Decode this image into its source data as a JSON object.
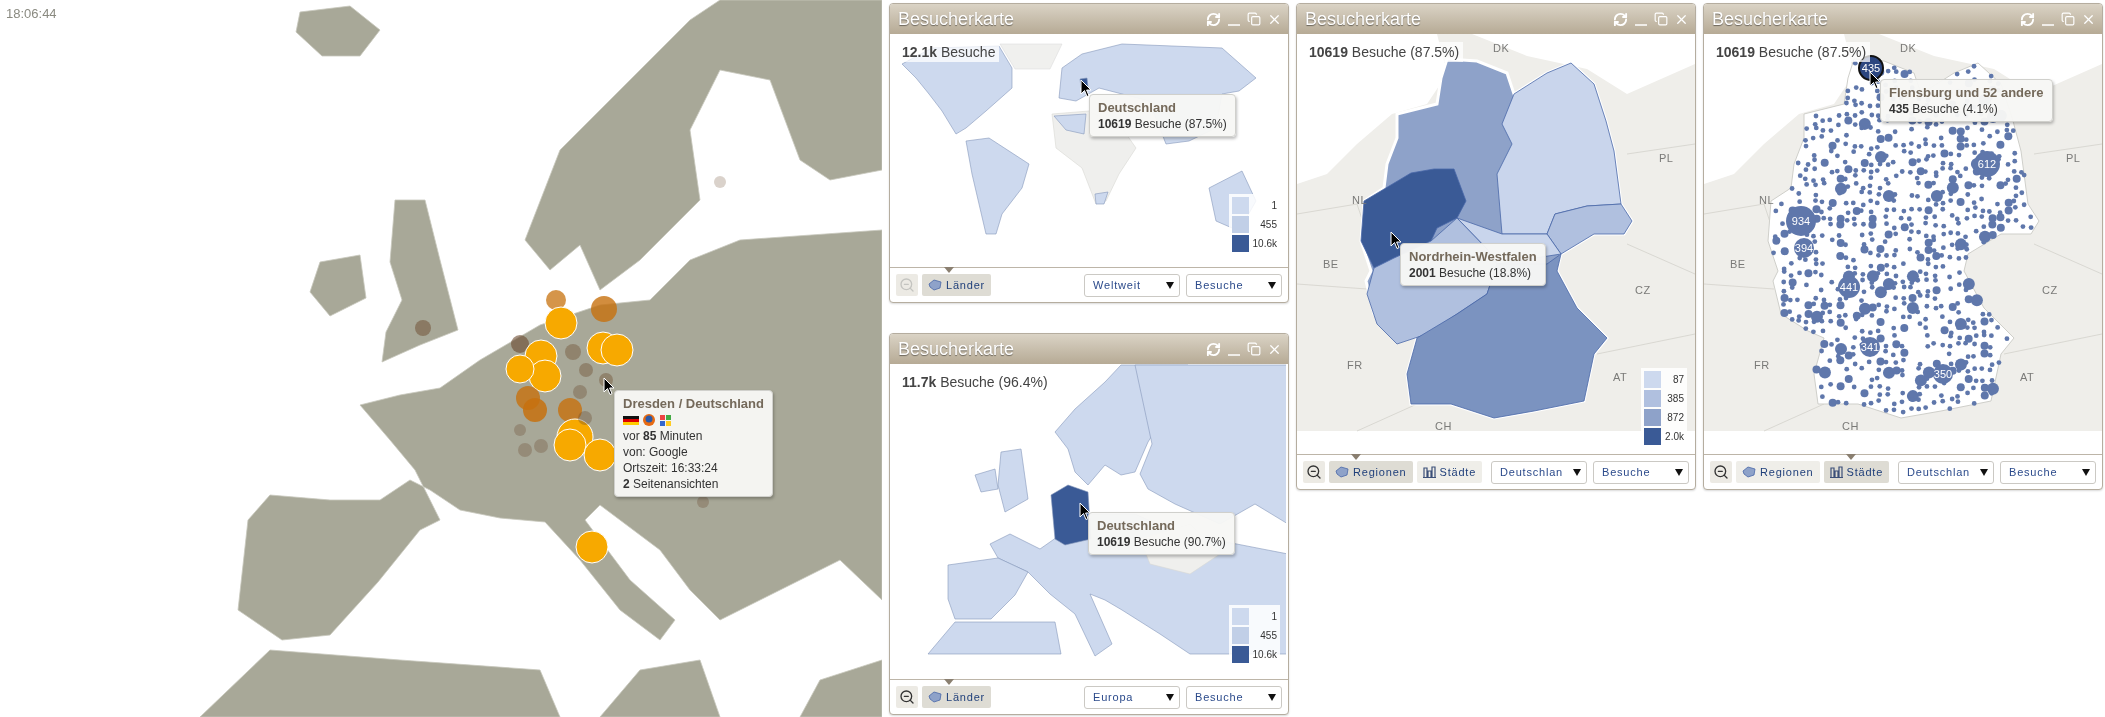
{
  "clock": "18:06:44",
  "live_map": {
    "tooltip": {
      "title": "Dresden / Deutschland",
      "lines": [
        "vor **85** Minuten",
        "von: Google",
        "Ortszeit: 16:33:24",
        "**2** Seitenansichten"
      ]
    }
  },
  "widgets": [
    {
      "title": "Besucherkarte",
      "kind": "world",
      "summary": "**12.1k** Besuche",
      "tooltip": {
        "title": "Deutschland",
        "text": "**10619** Besuche (87.5%)"
      },
      "legend": [
        {
          "label": "1",
          "color": "#cdd9ee"
        },
        {
          "label": "455",
          "color": "#c1cfe7"
        },
        {
          "label": "10.6k",
          "color": "#3a5a96"
        }
      ],
      "zoom_out_disabled": true,
      "view_tabs": [
        {
          "label": "Länder",
          "selected": true
        }
      ],
      "selects": [
        "Weltweit",
        "Besuche"
      ]
    },
    {
      "title": "Besucherkarte",
      "kind": "europe",
      "summary": "**11.7k** Besuche (96.4%)",
      "tooltip": {
        "title": "Deutschland",
        "text": "**10619** Besuche (90.7%)"
      },
      "legend": [
        {
          "label": "1",
          "color": "#cdd9ee"
        },
        {
          "label": "455",
          "color": "#c1cfe7"
        },
        {
          "label": "10.6k",
          "color": "#3a5a96"
        }
      ],
      "zoom_out_disabled": false,
      "view_tabs": [
        {
          "label": "Länder",
          "selected": true
        }
      ],
      "selects": [
        "Europa",
        "Besuche"
      ]
    },
    {
      "title": "Besucherkarte",
      "kind": "regions",
      "summary": "**10619** Besuche (87.5%)",
      "tooltip": {
        "title": "Nordrhein-Westfalen",
        "text": "**2001** Besuche (18.8%)"
      },
      "legend": [
        {
          "label": "87",
          "color": "#cdd9ee"
        },
        {
          "label": "385",
          "color": "#b0c0df"
        },
        {
          "label": "872",
          "color": "#8ea2c9"
        },
        {
          "label": "2.0k",
          "color": "#3a5a96"
        }
      ],
      "zoom_out_disabled": false,
      "view_tabs": [
        {
          "label": "Regionen",
          "selected": true
        },
        {
          "label": "Städte",
          "selected": false
        }
      ],
      "selects": [
        "Deutschlan",
        "Besuche"
      ],
      "country_labels": [
        "DK",
        "NL",
        "BE",
        "FR",
        "CH",
        "AT",
        "CZ",
        "PL"
      ]
    },
    {
      "title": "Besucherkarte",
      "kind": "cities",
      "summary": "**10619** Besuche (87.5%)",
      "tooltip": {
        "title": "Flensburg und 52 andere",
        "text": "**435** Besuche (4.1%)"
      },
      "zoom_out_disabled": false,
      "view_tabs": [
        {
          "label": "Regionen",
          "selected": false
        },
        {
          "label": "Städte",
          "selected": true
        }
      ],
      "selects": [
        "Deutschlan",
        "Besuche"
      ],
      "country_labels": [
        "DK",
        "NL",
        "BE",
        "FR",
        "CH",
        "AT",
        "CZ",
        "PL"
      ],
      "bubble_labels": [
        "435",
        "934",
        "394",
        "441",
        "341",
        "350",
        "612"
      ]
    }
  ]
}
